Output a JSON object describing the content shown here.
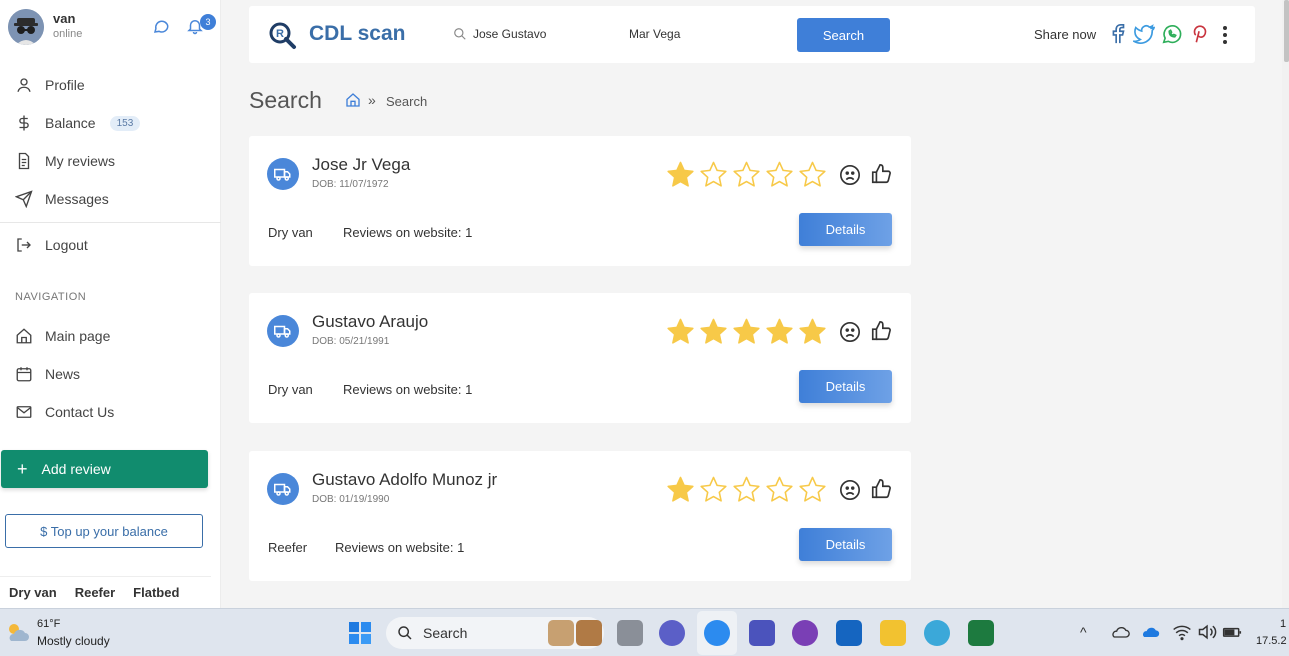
{
  "user": {
    "name": "van",
    "status": "online",
    "notifications": "3"
  },
  "sidebar": {
    "items": [
      {
        "label": "Profile"
      },
      {
        "label": "Balance",
        "badge": "153"
      },
      {
        "label": "My reviews"
      },
      {
        "label": "Messages"
      },
      {
        "label": "Logout"
      }
    ],
    "nav_heading": "NAVIGATION",
    "nav_items": [
      {
        "label": "Main page"
      },
      {
        "label": "News"
      },
      {
        "label": "Contact Us"
      }
    ],
    "add_review": "Add review",
    "topup": "$ Top up your balance",
    "filters": [
      "Dry van",
      "Reefer",
      "Flatbed"
    ]
  },
  "header": {
    "brand": "CDL scan",
    "search_first": "Jose Gustavo",
    "search_last": "Mar Vega",
    "search_button": "Search",
    "share_label": "Share now"
  },
  "page": {
    "title": "Search",
    "breadcrumb_sep": "»",
    "breadcrumb": "Search"
  },
  "results": [
    {
      "name": "Jose Jr Vega",
      "dob": "DOB: 11/07/1972",
      "rating": 1,
      "type": "Dry van",
      "reviews": "Reviews on website: 1",
      "details": "Details"
    },
    {
      "name": "Gustavo Araujo",
      "dob": "DOB: 05/21/1991",
      "rating": 5,
      "type": "Dry van",
      "reviews": "Reviews on website: 1",
      "details": "Details"
    },
    {
      "name": "Gustavo Adolfo Munoz jr",
      "dob": "DOB: 01/19/1990",
      "rating": 1,
      "type": "Reefer",
      "reviews": "Reviews on website: 1",
      "details": "Details"
    }
  ],
  "colors": {
    "accent": "#3f7fd8",
    "brand": "#3a6ea8",
    "add_review": "#118c6e",
    "star": "#f7c948"
  },
  "taskbar": {
    "temp": "61°F",
    "condition": "Mostly cloudy",
    "search": "Search",
    "clock_time": "1",
    "clock_date": "17.5.2"
  }
}
